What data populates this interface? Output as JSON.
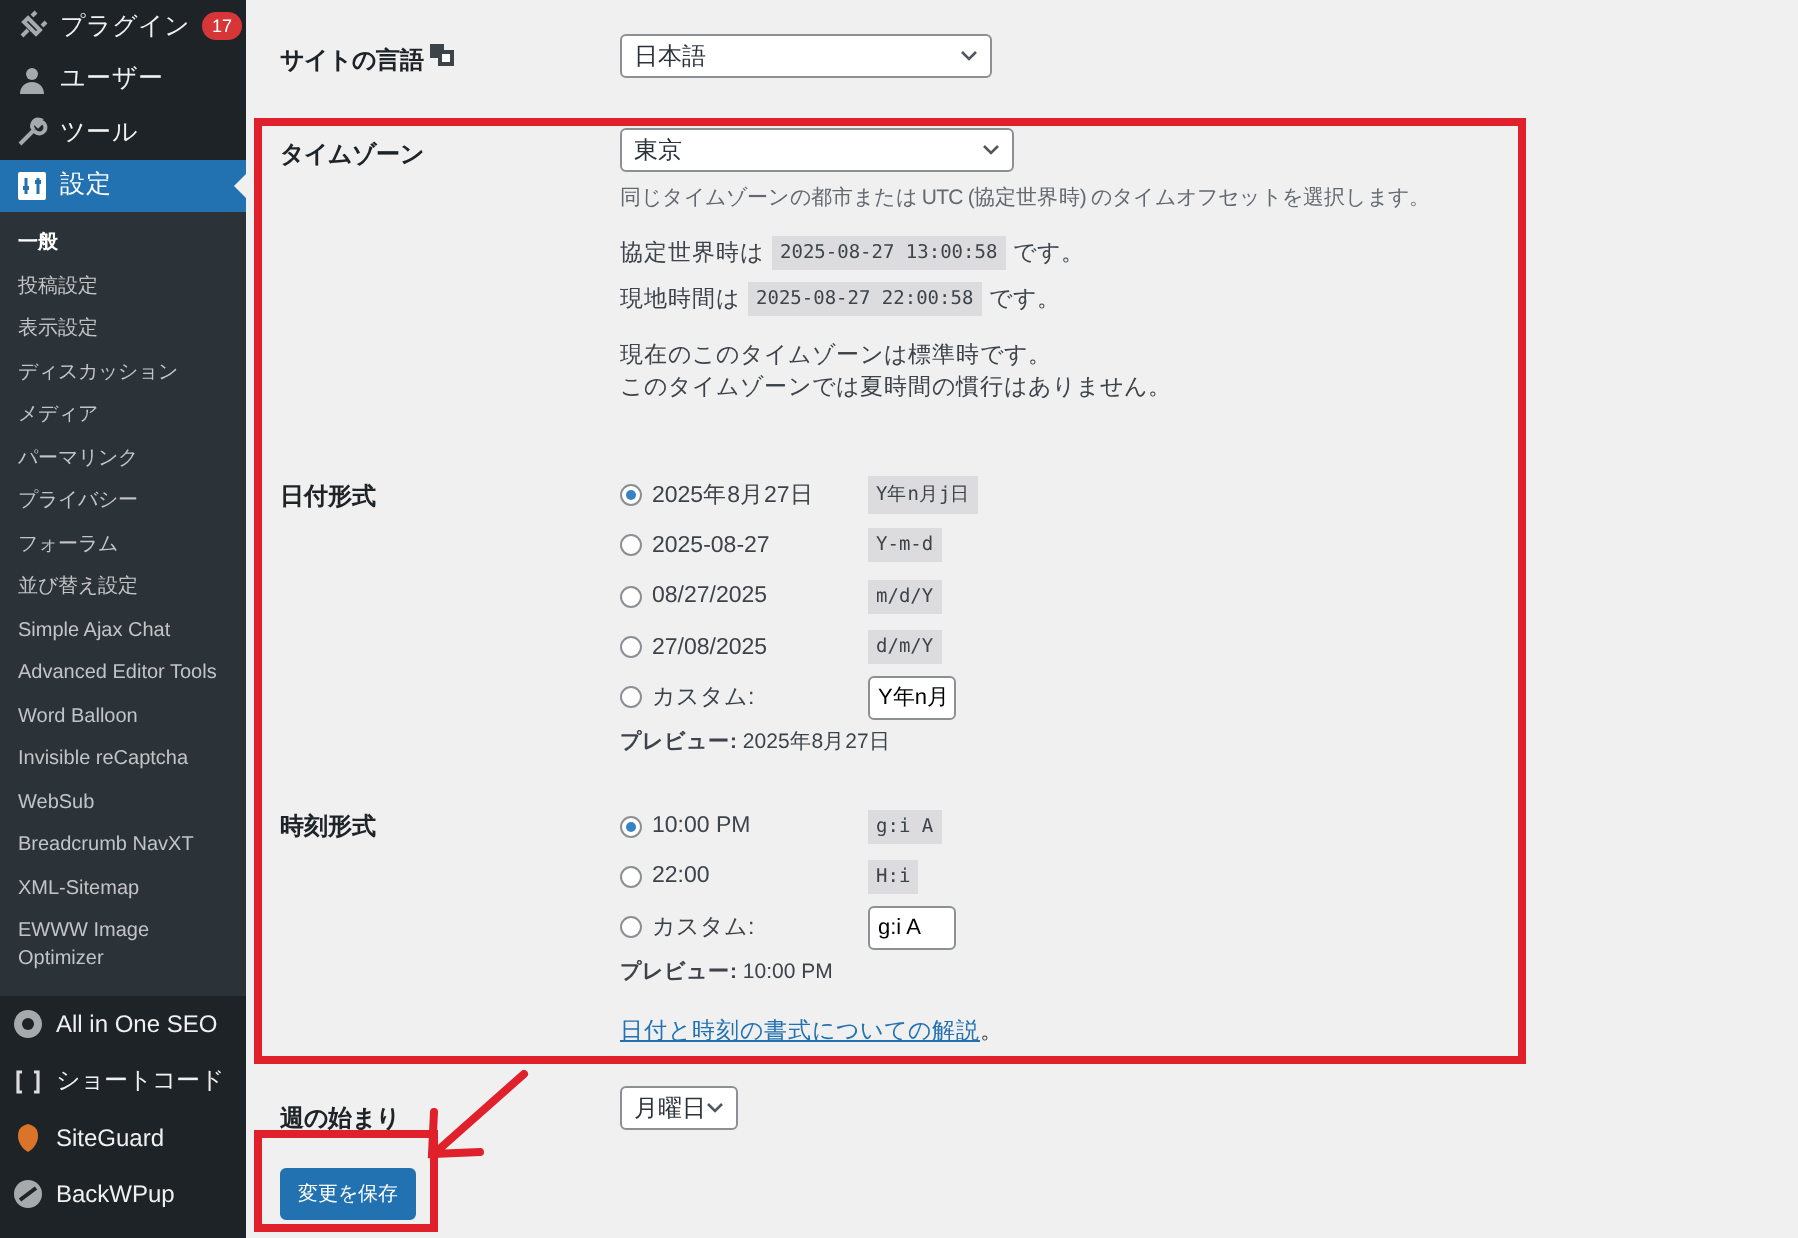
{
  "sidebar": {
    "menu": [
      {
        "label": "プラグイン",
        "badge": "17",
        "selected": false
      },
      {
        "label": "ユーザー",
        "selected": false
      },
      {
        "label": "ツール",
        "selected": false
      },
      {
        "label": "設定",
        "selected": true
      }
    ],
    "submenu": [
      {
        "label": "一般",
        "selected": true
      },
      {
        "label": "投稿設定",
        "selected": false
      },
      {
        "label": "表示設定",
        "selected": false
      },
      {
        "label": "ディスカッション",
        "selected": false
      },
      {
        "label": "メディア",
        "selected": false
      },
      {
        "label": "パーマリンク",
        "selected": false
      },
      {
        "label": "プライバシー",
        "selected": false
      },
      {
        "label": "フォーラム",
        "selected": false
      },
      {
        "label": "並び替え設定",
        "selected": false
      },
      {
        "label": "Simple Ajax Chat",
        "selected": false
      },
      {
        "label": "Advanced Editor Tools",
        "selected": false
      },
      {
        "label": "Word Balloon",
        "selected": false
      },
      {
        "label": "Invisible reCaptcha",
        "selected": false
      },
      {
        "label": "WebSub",
        "selected": false
      },
      {
        "label": "Breadcrumb NavXT",
        "selected": false
      },
      {
        "label": "XML-Sitemap",
        "selected": false
      },
      {
        "label": "EWWW Image Optimizer",
        "selected": false
      }
    ],
    "plugins": [
      {
        "label": "All in One SEO"
      },
      {
        "label": "ショートコード"
      },
      {
        "label": "SiteGuard"
      },
      {
        "label": "BackWPup"
      }
    ]
  },
  "language": {
    "label": "サイトの言語",
    "value": "日本語"
  },
  "timezone": {
    "label": "タイムゾーン",
    "value": "東京",
    "description": "同じタイムゾーンの都市または UTC (協定世界時) のタイムオフセットを選択します。",
    "times": [
      {
        "prefix": "協定世界時は",
        "code": "2025-08-27 13:00:58",
        "suffix": "です。"
      },
      {
        "prefix": "現地時間は",
        "code": "2025-08-27 22:00:58",
        "suffix": "です。"
      }
    ],
    "notes": [
      "現在のこのタイムゾーンは標準時です。",
      "このタイムゾーンでは夏時間の慣行はありません。"
    ]
  },
  "date_format": {
    "label": "日付形式",
    "options": [
      {
        "kind": "preset",
        "label": "2025年8月27日",
        "code": "Y年n月j日",
        "selected": true
      },
      {
        "kind": "preset",
        "label": "2025-08-27",
        "code": "Y-m-d",
        "selected": false
      },
      {
        "kind": "preset",
        "label": "08/27/2025",
        "code": "m/d/Y",
        "selected": false
      },
      {
        "kind": "preset",
        "label": "27/08/2025",
        "code": "d/m/Y",
        "selected": false
      },
      {
        "kind": "custom",
        "label": "カスタム:",
        "value": "Y年n月",
        "selected": false
      }
    ],
    "preview_label": "プレビュー:",
    "preview": "2025年8月27日"
  },
  "time_format": {
    "label": "時刻形式",
    "options": [
      {
        "kind": "preset",
        "label": "10:00 PM",
        "code": "g:i A",
        "selected": true
      },
      {
        "kind": "preset",
        "label": "22:00",
        "code": "H:i",
        "selected": false
      },
      {
        "kind": "custom",
        "label": "カスタム:",
        "value": "g:i A",
        "selected": false
      }
    ],
    "preview_label": "プレビュー:",
    "preview": "10:00 PM"
  },
  "help_link": {
    "text": "日付と時刻の書式についての解説",
    "suffix": "。"
  },
  "week_start": {
    "label": "週の始まり",
    "value": "月曜日"
  },
  "save_button": "変更を保存"
}
